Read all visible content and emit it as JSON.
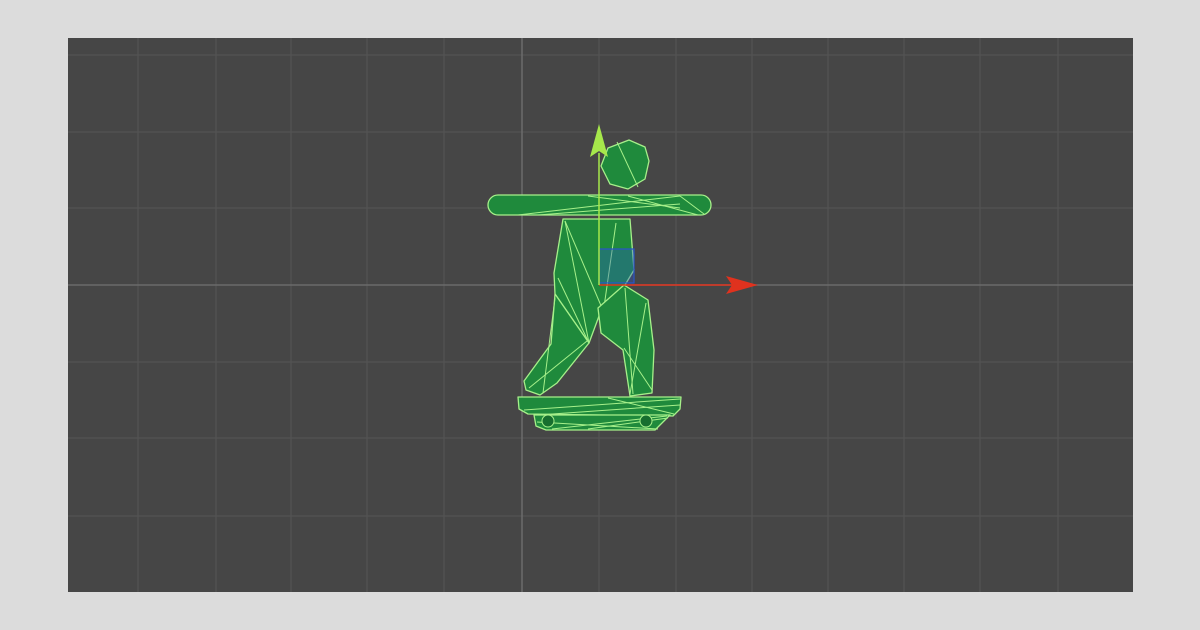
{
  "page": {
    "background_color": "#dcdcdc"
  },
  "scene_view": {
    "background_color": "#464646",
    "grid": {
      "visible": true,
      "line_color": "#555555",
      "axis_line_color": "#6a6a6a"
    },
    "selected_object": {
      "icon": "skateboarder-wireframe-icon",
      "fill_color": "#1f8a3c",
      "wire_color": "#a6f08a"
    },
    "gizmo": {
      "x_axis_color": "#e0321e",
      "y_axis_color": "#a6e84b",
      "z_plane_color": "#2a55c8"
    }
  }
}
